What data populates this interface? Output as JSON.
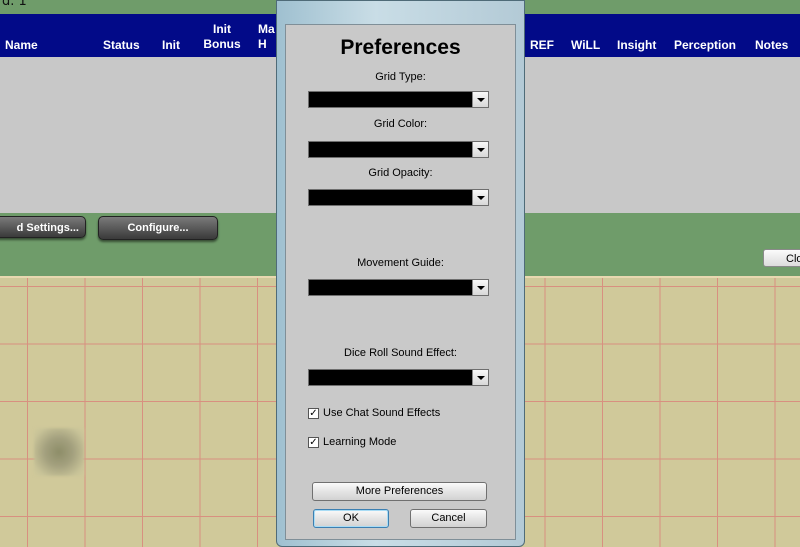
{
  "top_strip": {
    "text": "d.  1"
  },
  "tracker_header": {
    "columns": [
      {
        "line1": "",
        "line2": "Name"
      },
      {
        "line1": "",
        "line2": "Status"
      },
      {
        "line1": "",
        "line2": "Init"
      },
      {
        "line1": "Init",
        "line2": "Bonus"
      },
      {
        "line1": "Ma",
        "line2": "H"
      },
      {
        "line1": "",
        "line2": "REF"
      },
      {
        "line1": "",
        "line2": "WiLL"
      },
      {
        "line1": "",
        "line2": "Insight"
      },
      {
        "line1": "",
        "line2": "Perception"
      },
      {
        "line1": "",
        "line2": "Notes"
      }
    ]
  },
  "button_bar": {
    "settings_label": "d Settings...",
    "configure_label": "Configure...",
    "close_label": "Clo"
  },
  "dialog": {
    "title": "Preferences",
    "fields": [
      {
        "label": "Grid Type:",
        "value": ""
      },
      {
        "label": "Grid Color:",
        "value": ""
      },
      {
        "label": "Grid Opacity:",
        "value": ""
      },
      {
        "label": "Movement Guide:",
        "value": ""
      },
      {
        "label": "Dice Roll Sound Effect:",
        "value": ""
      }
    ],
    "checkboxes": [
      {
        "label": "Use Chat Sound Effects",
        "checked": true
      },
      {
        "label": "Learning Mode",
        "checked": true
      }
    ],
    "check_mark": "✓",
    "more_label": "More Preferences",
    "ok_label": "OK",
    "cancel_label": "Cancel"
  }
}
